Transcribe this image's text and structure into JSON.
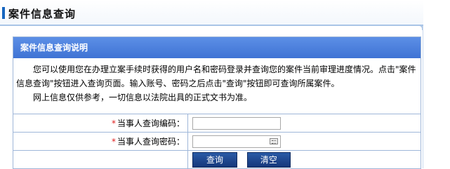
{
  "header": {
    "title": "案件信息查询"
  },
  "panel": {
    "heading": "案件信息查询说明",
    "paragraph1": "您可以使用您在办理立案手续时获得的用户名和密码登录并查询您的案件当前审理进度情况。点击\"案件信息查询\"按钮进入查询页面。输入账号、密码之后点击\"查询\"按钮即可查询所属案件。",
    "paragraph2": "网上信息仅供参考，一切信息以法院出具的正式文书为准。"
  },
  "form": {
    "required_mark": "*",
    "code_label": "当事人查询编码：",
    "code_value": "",
    "password_label": "当事人查询密码：",
    "password_value": "",
    "query_button": "查询",
    "clear_button": "清空"
  }
}
